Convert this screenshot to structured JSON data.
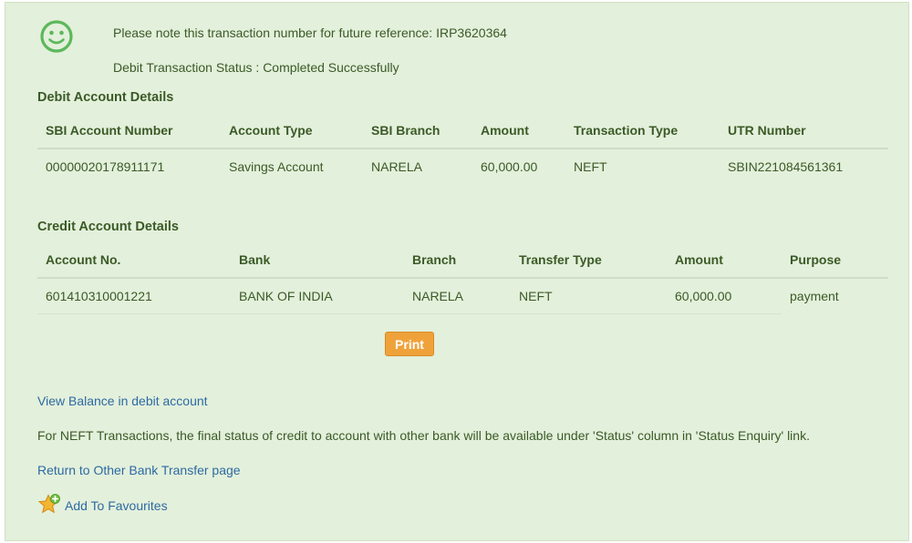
{
  "confirmation": {
    "reference_note": "Please note this transaction number for future reference: IRP3620364",
    "debit_status": "Debit Transaction Status : Completed Successfully"
  },
  "debit_section": {
    "title": "Debit Account Details",
    "headers": [
      "SBI Account Number",
      "Account Type",
      "SBI Branch",
      "Amount",
      "Transaction Type",
      "UTR Number"
    ],
    "row": [
      "00000020178911171",
      "Savings Account",
      "NARELA",
      "60,000.00",
      "NEFT",
      "SBIN221084561361"
    ]
  },
  "credit_section": {
    "title": "Credit Account Details",
    "headers": [
      "Account No.",
      "Bank",
      "Branch",
      "Transfer Type",
      "Amount",
      "Purpose"
    ],
    "row": [
      "601410310001221",
      "BANK OF INDIA",
      "NARELA",
      "NEFT",
      "60,000.00",
      "payment"
    ]
  },
  "actions": {
    "print_label": "Print",
    "view_balance_link": "View Balance in debit account",
    "neft_info": "For NEFT Transactions, the final status of credit to account with other bank will be available under 'Status' column in 'Status Enquiry' link.",
    "return_link": "Return to Other Bank Transfer page",
    "favourites_link": "Add To Favourites"
  },
  "colors": {
    "panel_bg": "#e3f0db",
    "text_green": "#3b5a27",
    "link_blue": "#2d6aa3",
    "button_orange": "#f0a23a",
    "smiley_green": "#5cb85c"
  },
  "icons": {
    "status": "smiley-icon",
    "favourite": "star-plus-icon"
  }
}
